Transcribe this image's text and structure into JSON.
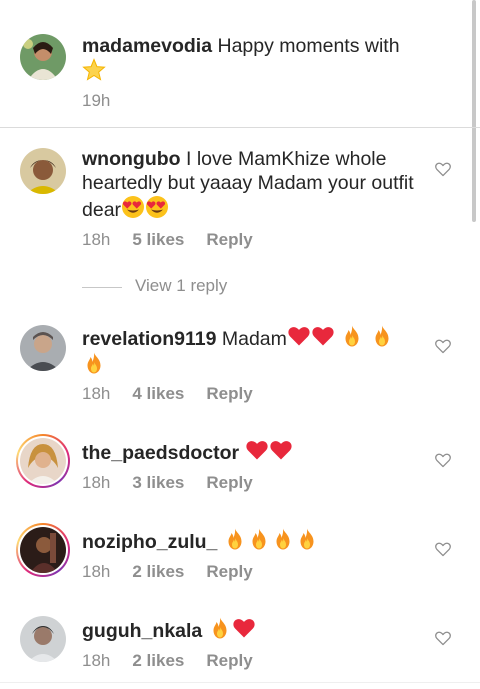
{
  "comments": [
    {
      "username": "madamevodia",
      "text": "Happy moments with",
      "emojis": [
        "star"
      ],
      "time": "19h",
      "likes": "",
      "reply": ""
    },
    {
      "username": "wnongubo",
      "text": "I love MamKhize whole heartedly but yaaay Madam your outfit dear",
      "emojis": [
        "heart-eyes",
        "heart-eyes"
      ],
      "time": "18h",
      "likes": "5 likes",
      "reply": "Reply"
    },
    {
      "username": "revelation9119",
      "text": "Madam",
      "emojis": [
        "red-heart",
        "red-heart",
        "fire",
        "fire",
        "fire"
      ],
      "time": "18h",
      "likes": "4 likes",
      "reply": "Reply"
    },
    {
      "username": "the_paedsdoctor",
      "text": "",
      "emojis": [
        "red-heart",
        "red-heart"
      ],
      "time": "18h",
      "likes": "3 likes",
      "reply": "Reply"
    },
    {
      "username": "nozipho_zulu_",
      "text": "",
      "emojis": [
        "fire",
        "fire",
        "fire",
        "fire"
      ],
      "time": "18h",
      "likes": "2 likes",
      "reply": "Reply"
    },
    {
      "username": "guguh_nkala",
      "text": "",
      "emojis": [
        "fire",
        "red-heart"
      ],
      "time": "18h",
      "likes": "2 likes",
      "reply": "Reply"
    }
  ],
  "view_replies": "View 1 reply",
  "icons": {
    "like": "heart-outline-icon"
  },
  "colors": {
    "text": "#262626",
    "secondary": "#8e8e8e",
    "heart": "#ed2f45",
    "fire": "#f7931e"
  }
}
